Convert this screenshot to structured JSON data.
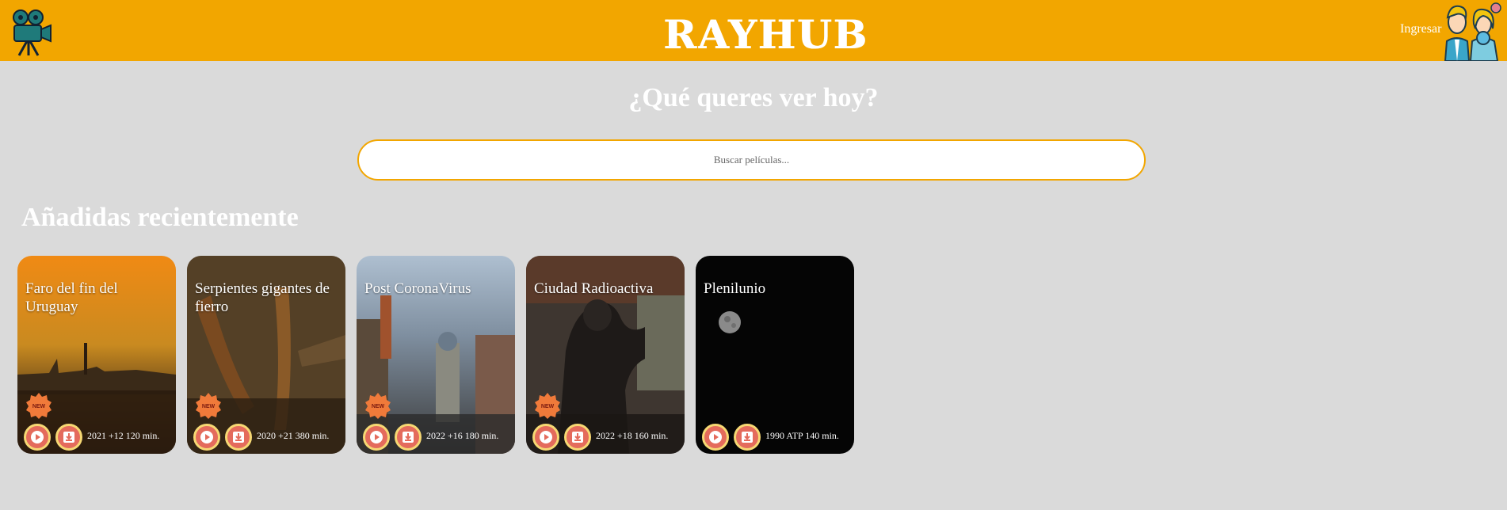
{
  "header": {
    "brand": "RAYHUB",
    "login_label": "Ingresar",
    "logo_icon": "movie-camera-icon",
    "avatar_icon": "users-avatar-icon",
    "bg_color": "#f2a600"
  },
  "hero": {
    "title": "¿Qué queres ver hoy?",
    "search_placeholder": "Buscar películas..."
  },
  "section": {
    "title": "Añadidas recientemente"
  },
  "movies": [
    {
      "title": "Faro del fin del Uruguay",
      "meta": "2021 +12 120 min.",
      "is_new": true
    },
    {
      "title": "Serpientes gigantes de fierro",
      "meta": "2020 +21 380 min.",
      "is_new": true
    },
    {
      "title": "Post CoronaVirus",
      "meta": "2022 +16 180 min.",
      "is_new": true
    },
    {
      "title": "Ciudad Radioactiva",
      "meta": "2022 +18 160 min.",
      "is_new": true
    },
    {
      "title": "Plenilunio",
      "meta": "1990 ATP 140 min.",
      "is_new": false
    }
  ],
  "badge_label": "NEW"
}
